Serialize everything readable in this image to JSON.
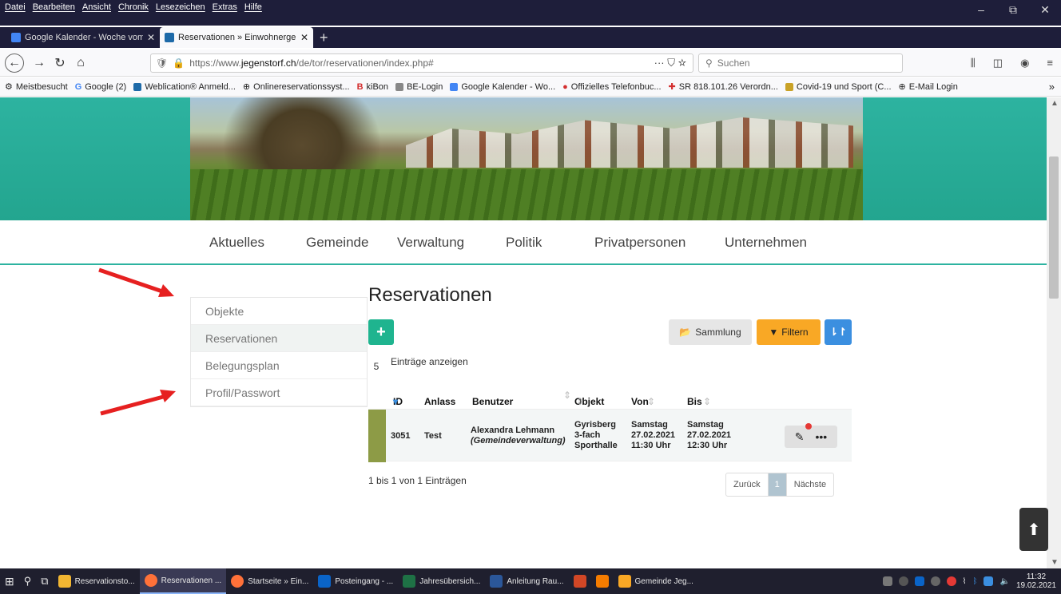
{
  "menubar": {
    "items": [
      "Datei",
      "Bearbeiten",
      "Ansicht",
      "Chronik",
      "Lesezeichen",
      "Extras",
      "Hilfe"
    ]
  },
  "window_controls": {
    "minimize": "–",
    "restore": "⧉",
    "close": "✕"
  },
  "tabs": [
    {
      "label": "Google Kalender - Woche vom",
      "icon_color": "#4285f4",
      "active": false
    },
    {
      "label": "Reservationen » Einwohnergem",
      "icon_color": "#1e6aa8",
      "active": true
    }
  ],
  "newtab_label": "+",
  "navbar": {
    "url_prefix": "https://www.",
    "url_host": "jegenstorf.ch",
    "url_path": "/de/tor/reservationen/index.php#",
    "url_actions": "··· ⛉ ☆",
    "search_placeholder": "Suchen"
  },
  "bookmarks": [
    "Meistbesucht",
    "Google (2)",
    "Weblication® Anmeld...",
    "Onlinereservationssyst...",
    "kiBon",
    "BE-Login",
    "Google Kalender - Wo...",
    "Offizielles Telefonbuc...",
    "SR 818.101.26 Verordn...",
    "Covid-19 und Sport (C...",
    "E-Mail Login"
  ],
  "bookmarks_more": "»",
  "mainnav": [
    "Aktuelles",
    "Gemeinde",
    "Verwaltung",
    "Politik",
    "Privatpersonen",
    "Unternehmen"
  ],
  "sidemenu": [
    {
      "label": "Objekte",
      "active": false
    },
    {
      "label": "Reservationen",
      "active": true
    },
    {
      "label": "Belegungsplan",
      "active": false
    },
    {
      "label": "Profil/Passwort",
      "active": false
    }
  ],
  "content": {
    "title": "Reservationen",
    "add_label": "+",
    "sammlung_label": "Sammlung",
    "filter_label": "Filtern",
    "sort_label": "⇂↾",
    "entries_count": "5",
    "entries_label": "Einträge anzeigen",
    "columns": [
      "ID",
      "Anlass",
      "Benutzer",
      "Objekt",
      "Von",
      "Bis"
    ],
    "row": {
      "id": "3051",
      "anlass": "Test",
      "benutzer_name": "Alexandra Lehmann",
      "benutzer_org": "(Gemeindeverwaltung)",
      "objekt": [
        "Gyrisberg",
        "3-fach",
        "Sporthalle"
      ],
      "von": [
        "Samstag",
        "27.02.2021",
        "11:30 Uhr"
      ],
      "bis": [
        "Samstag",
        "27.02.2021",
        "12:30 Uhr"
      ],
      "more": "•••"
    },
    "info": "1 bis 1 von 1 Einträgen",
    "pager": {
      "prev": "Zurück",
      "current": "1",
      "next": "Nächste"
    }
  },
  "taskbar": [
    {
      "label": "Reservationsto...",
      "color": "#f2b632",
      "active": false
    },
    {
      "label": "Reservationen ...",
      "color": "#ff7139",
      "active": true
    },
    {
      "label": "Startseite » Ein...",
      "color": "#ff7139",
      "active": false
    },
    {
      "label": "Posteingang - ...",
      "color": "#0a64c8",
      "active": false
    },
    {
      "label": "Jahresübersich...",
      "color": "#1e7145",
      "active": false
    },
    {
      "label": "Anleitung Rau...",
      "color": "#2b579a",
      "active": false
    },
    {
      "label": "",
      "color": "#d24726",
      "active": false
    },
    {
      "label": "",
      "color": "#f57c00",
      "active": false
    },
    {
      "label": "Gemeinde Jeg...",
      "color": "#f9a825",
      "active": false
    }
  ],
  "clock": {
    "time": "11:32",
    "date": "19.02.2021"
  },
  "accent_color": "#2db3a0"
}
